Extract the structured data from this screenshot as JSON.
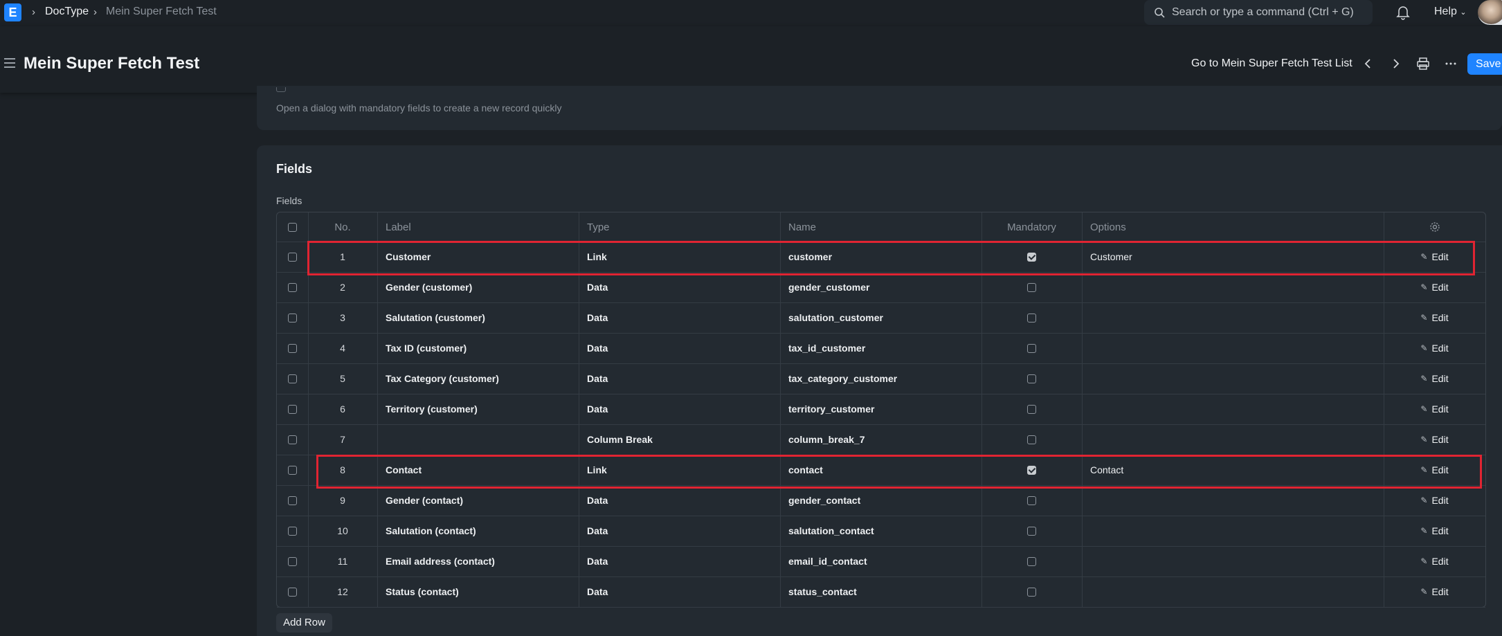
{
  "navbar": {
    "logo": "E",
    "breadcrumbs": [
      "DocType",
      "Mein Super Fetch Test"
    ],
    "search_placeholder": "Search or type a command (Ctrl + G)",
    "help_label": "Help"
  },
  "header": {
    "title": "Mein Super Fetch Test",
    "goto_label": "Go to Mein Super Fetch Test List",
    "save_label": "Save"
  },
  "quick_entry": {
    "description": "Open a dialog with mandatory fields to create a new record quickly"
  },
  "fields_section": {
    "title": "Fields",
    "table_label": "Fields",
    "columns": [
      "No.",
      "Label",
      "Type",
      "Name",
      "Mandatory",
      "Options"
    ],
    "rows": [
      {
        "no": "1",
        "label": "Customer",
        "type": "Link",
        "name": "customer",
        "mandatory": true,
        "options": "Customer",
        "edit": "Edit"
      },
      {
        "no": "2",
        "label": "Gender (customer)",
        "type": "Data",
        "name": "gender_customer",
        "mandatory": false,
        "options": "",
        "edit": "Edit"
      },
      {
        "no": "3",
        "label": "Salutation (customer)",
        "type": "Data",
        "name": "salutation_customer",
        "mandatory": false,
        "options": "",
        "edit": "Edit"
      },
      {
        "no": "4",
        "label": "Tax ID (customer)",
        "type": "Data",
        "name": "tax_id_customer",
        "mandatory": false,
        "options": "",
        "edit": "Edit"
      },
      {
        "no": "5",
        "label": "Tax Category (customer)",
        "type": "Data",
        "name": "tax_category_customer",
        "mandatory": false,
        "options": "",
        "edit": "Edit"
      },
      {
        "no": "6",
        "label": "Territory (customer)",
        "type": "Data",
        "name": "territory_customer",
        "mandatory": false,
        "options": "",
        "edit": "Edit"
      },
      {
        "no": "7",
        "label": "",
        "type": "Column Break",
        "name": "column_break_7",
        "mandatory": false,
        "options": "",
        "edit": "Edit"
      },
      {
        "no": "8",
        "label": "Contact",
        "type": "Link",
        "name": "contact",
        "mandatory": true,
        "options": "Contact",
        "edit": "Edit"
      },
      {
        "no": "9",
        "label": "Gender (contact)",
        "type": "Data",
        "name": "gender_contact",
        "mandatory": false,
        "options": "",
        "edit": "Edit"
      },
      {
        "no": "10",
        "label": "Salutation (contact)",
        "type": "Data",
        "name": "salutation_contact",
        "mandatory": false,
        "options": "",
        "edit": "Edit"
      },
      {
        "no": "11",
        "label": "Email address (contact)",
        "type": "Data",
        "name": "email_id_contact",
        "mandatory": false,
        "options": "",
        "edit": "Edit"
      },
      {
        "no": "12",
        "label": "Status (contact)",
        "type": "Data",
        "name": "status_contact",
        "mandatory": false,
        "options": "",
        "edit": "Edit"
      }
    ],
    "add_row_label": "Add Row"
  },
  "colors": {
    "accent": "#1f84ff",
    "highlight": "#e02432",
    "background": "#1c2126",
    "card": "#232a31"
  }
}
